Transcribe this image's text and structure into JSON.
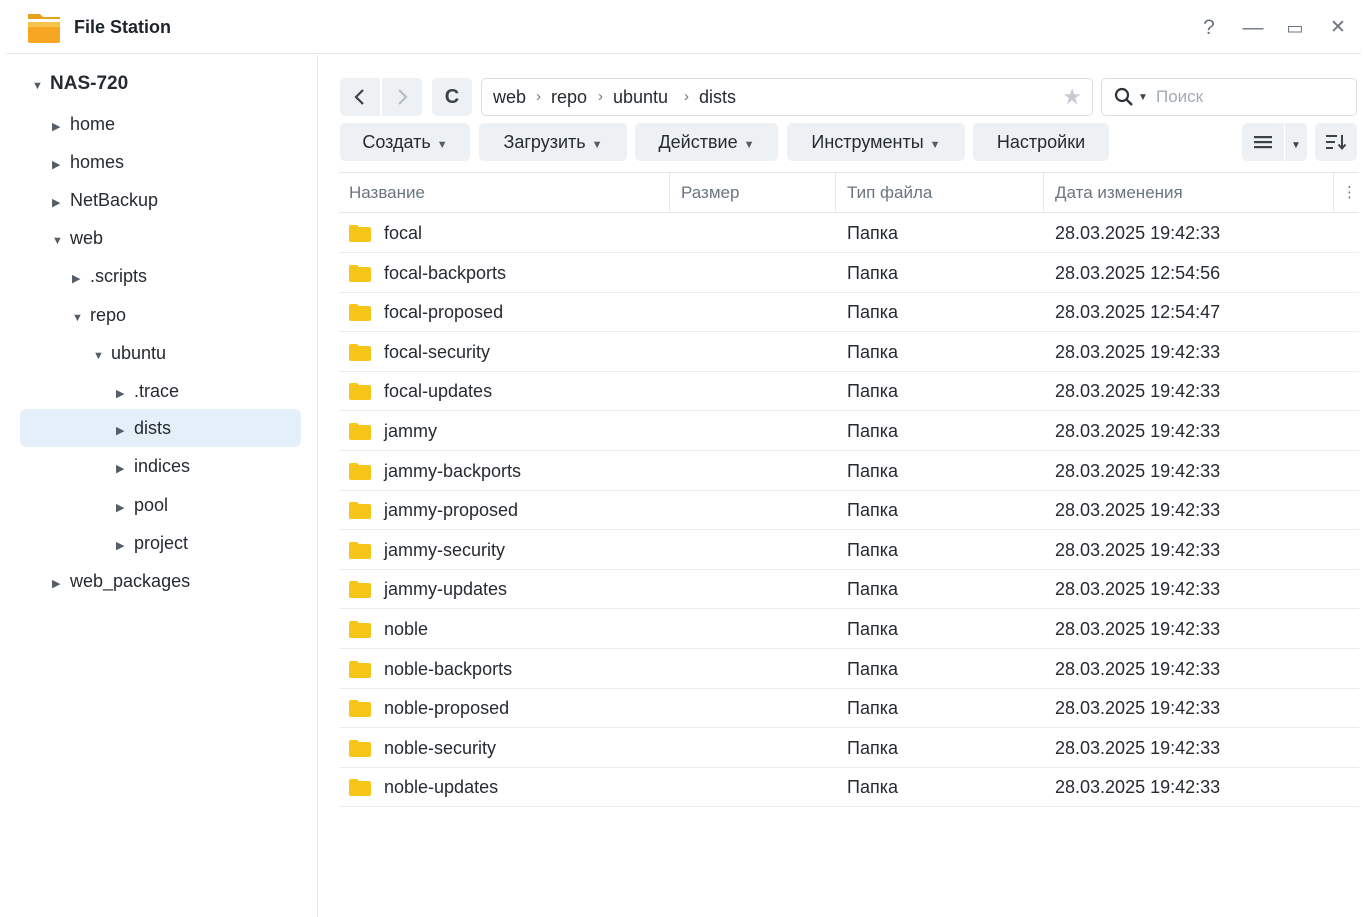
{
  "app": {
    "title": "File Station",
    "controls": {
      "help": "?",
      "minimize": "—",
      "maximize": "▭",
      "close": "✕"
    }
  },
  "sidebar": {
    "root": "NAS-720",
    "items": [
      {
        "label": "home",
        "expanded": false,
        "selected": false
      },
      {
        "label": "homes",
        "expanded": false,
        "selected": false
      },
      {
        "label": "NetBackup",
        "expanded": false,
        "selected": false
      },
      {
        "label": "web",
        "expanded": true,
        "selected": false
      },
      {
        "label": ".scripts",
        "expanded": false,
        "selected": false
      },
      {
        "label": "repo",
        "expanded": true,
        "selected": false
      },
      {
        "label": "ubuntu",
        "expanded": true,
        "selected": false
      },
      {
        "label": ".trace",
        "expanded": false,
        "selected": false
      },
      {
        "label": "dists",
        "expanded": false,
        "selected": true
      },
      {
        "label": "indices",
        "expanded": false,
        "selected": false
      },
      {
        "label": "pool",
        "expanded": false,
        "selected": false
      },
      {
        "label": "project",
        "expanded": false,
        "selected": false
      },
      {
        "label": "web_packages",
        "expanded": false,
        "selected": false
      }
    ]
  },
  "toolbar": {
    "refresh_icon": "C",
    "path": [
      "web",
      "repo",
      "ubuntu",
      "dists"
    ],
    "path_separator": "›",
    "search_placeholder": "Поиск",
    "buttons": {
      "create": "Создать",
      "upload": "Загрузить",
      "action": "Действие",
      "tools": "Инструменты",
      "settings": "Настройки"
    }
  },
  "table": {
    "columns": [
      "Название",
      "Размер",
      "Тип файла",
      "Дата изменения"
    ],
    "rows": [
      {
        "name": "focal",
        "size": "",
        "type": "Папка",
        "modified": "28.03.2025 19:42:33"
      },
      {
        "name": "focal-backports",
        "size": "",
        "type": "Папка",
        "modified": "28.03.2025 12:54:56"
      },
      {
        "name": "focal-proposed",
        "size": "",
        "type": "Папка",
        "modified": "28.03.2025 12:54:47"
      },
      {
        "name": "focal-security",
        "size": "",
        "type": "Папка",
        "modified": "28.03.2025 19:42:33"
      },
      {
        "name": "focal-updates",
        "size": "",
        "type": "Папка",
        "modified": "28.03.2025 19:42:33"
      },
      {
        "name": "jammy",
        "size": "",
        "type": "Папка",
        "modified": "28.03.2025 19:42:33"
      },
      {
        "name": "jammy-backports",
        "size": "",
        "type": "Папка",
        "modified": "28.03.2025 19:42:33"
      },
      {
        "name": "jammy-proposed",
        "size": "",
        "type": "Папка",
        "modified": "28.03.2025 19:42:33"
      },
      {
        "name": "jammy-security",
        "size": "",
        "type": "Папка",
        "modified": "28.03.2025 19:42:33"
      },
      {
        "name": "jammy-updates",
        "size": "",
        "type": "Папка",
        "modified": "28.03.2025 19:42:33"
      },
      {
        "name": "noble",
        "size": "",
        "type": "Папка",
        "modified": "28.03.2025 19:42:33"
      },
      {
        "name": "noble-backports",
        "size": "",
        "type": "Папка",
        "modified": "28.03.2025 19:42:33"
      },
      {
        "name": "noble-proposed",
        "size": "",
        "type": "Папка",
        "modified": "28.03.2025 19:42:33"
      },
      {
        "name": "noble-security",
        "size": "",
        "type": "Папка",
        "modified": "28.03.2025 19:42:33"
      },
      {
        "name": "noble-updates",
        "size": "",
        "type": "Папка",
        "modified": "28.03.2025 19:42:33"
      }
    ]
  },
  "colors": {
    "folder": "#f5c518",
    "selected_bg": "#e5effa",
    "button_bg": "#eef1f4",
    "header_text": "#6b7480"
  }
}
